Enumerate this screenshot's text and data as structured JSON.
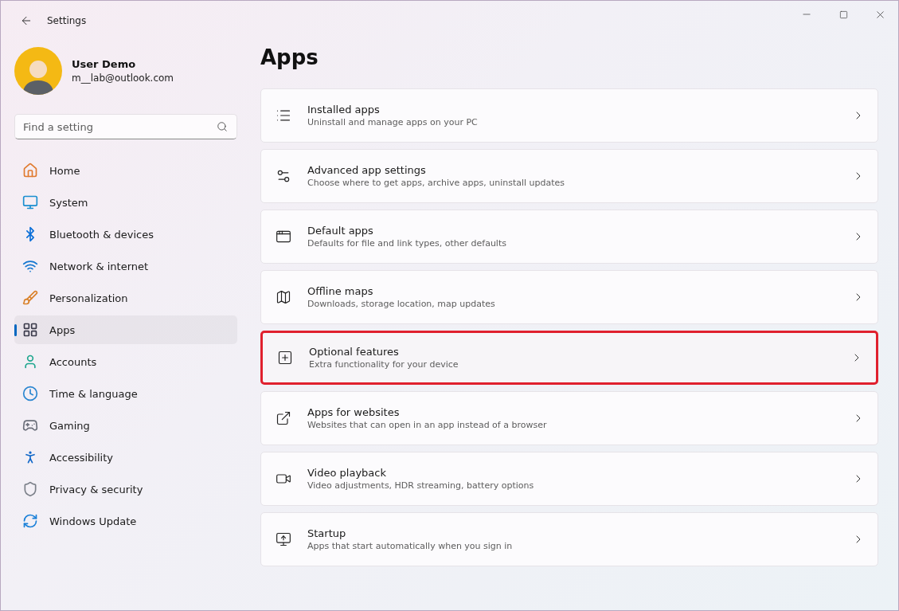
{
  "window": {
    "title": "Settings"
  },
  "user": {
    "name": "User Demo",
    "email": "m__lab@outlook.com"
  },
  "search": {
    "placeholder": "Find a setting"
  },
  "nav": [
    {
      "label": "Home",
      "selected": false
    },
    {
      "label": "System",
      "selected": false
    },
    {
      "label": "Bluetooth & devices",
      "selected": false
    },
    {
      "label": "Network & internet",
      "selected": false
    },
    {
      "label": "Personalization",
      "selected": false
    },
    {
      "label": "Apps",
      "selected": true
    },
    {
      "label": "Accounts",
      "selected": false
    },
    {
      "label": "Time & language",
      "selected": false
    },
    {
      "label": "Gaming",
      "selected": false
    },
    {
      "label": "Accessibility",
      "selected": false
    },
    {
      "label": "Privacy & security",
      "selected": false
    },
    {
      "label": "Windows Update",
      "selected": false
    }
  ],
  "page_title": "Apps",
  "cards": [
    {
      "title": "Installed apps",
      "subtitle": "Uninstall and manage apps on your PC",
      "highlighted": false
    },
    {
      "title": "Advanced app settings",
      "subtitle": "Choose where to get apps, archive apps, uninstall updates",
      "highlighted": false
    },
    {
      "title": "Default apps",
      "subtitle": "Defaults for file and link types, other defaults",
      "highlighted": false
    },
    {
      "title": "Offline maps",
      "subtitle": "Downloads, storage location, map updates",
      "highlighted": false
    },
    {
      "title": "Optional features",
      "subtitle": "Extra functionality for your device",
      "highlighted": true
    },
    {
      "title": "Apps for websites",
      "subtitle": "Websites that can open in an app instead of a browser",
      "highlighted": false
    },
    {
      "title": "Video playback",
      "subtitle": "Video adjustments, HDR streaming, battery options",
      "highlighted": false
    },
    {
      "title": "Startup",
      "subtitle": "Apps that start automatically when you sign in",
      "highlighted": false
    }
  ]
}
